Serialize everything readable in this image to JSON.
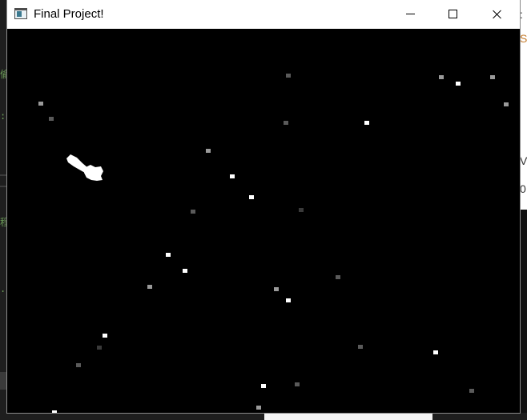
{
  "window": {
    "title": "Final Project!",
    "icon": "window-app-icon",
    "controls": [
      "minimize-icon",
      "maximize-icon",
      "close-icon"
    ]
  },
  "background": {
    "left_fragments": [
      "偷",
      ":",
      "程",
      ".("
    ],
    "right_fragments": [
      ":",
      "S",
      "V",
      "0"
    ]
  },
  "game": {
    "background_color": "#000000",
    "star_colors": {
      "bright": "#ffffff",
      "mid": "#9a9a9a",
      "dim": "#5a5a5a",
      "faint": "#3a3a3a"
    },
    "ship_color": "#ffffff"
  }
}
